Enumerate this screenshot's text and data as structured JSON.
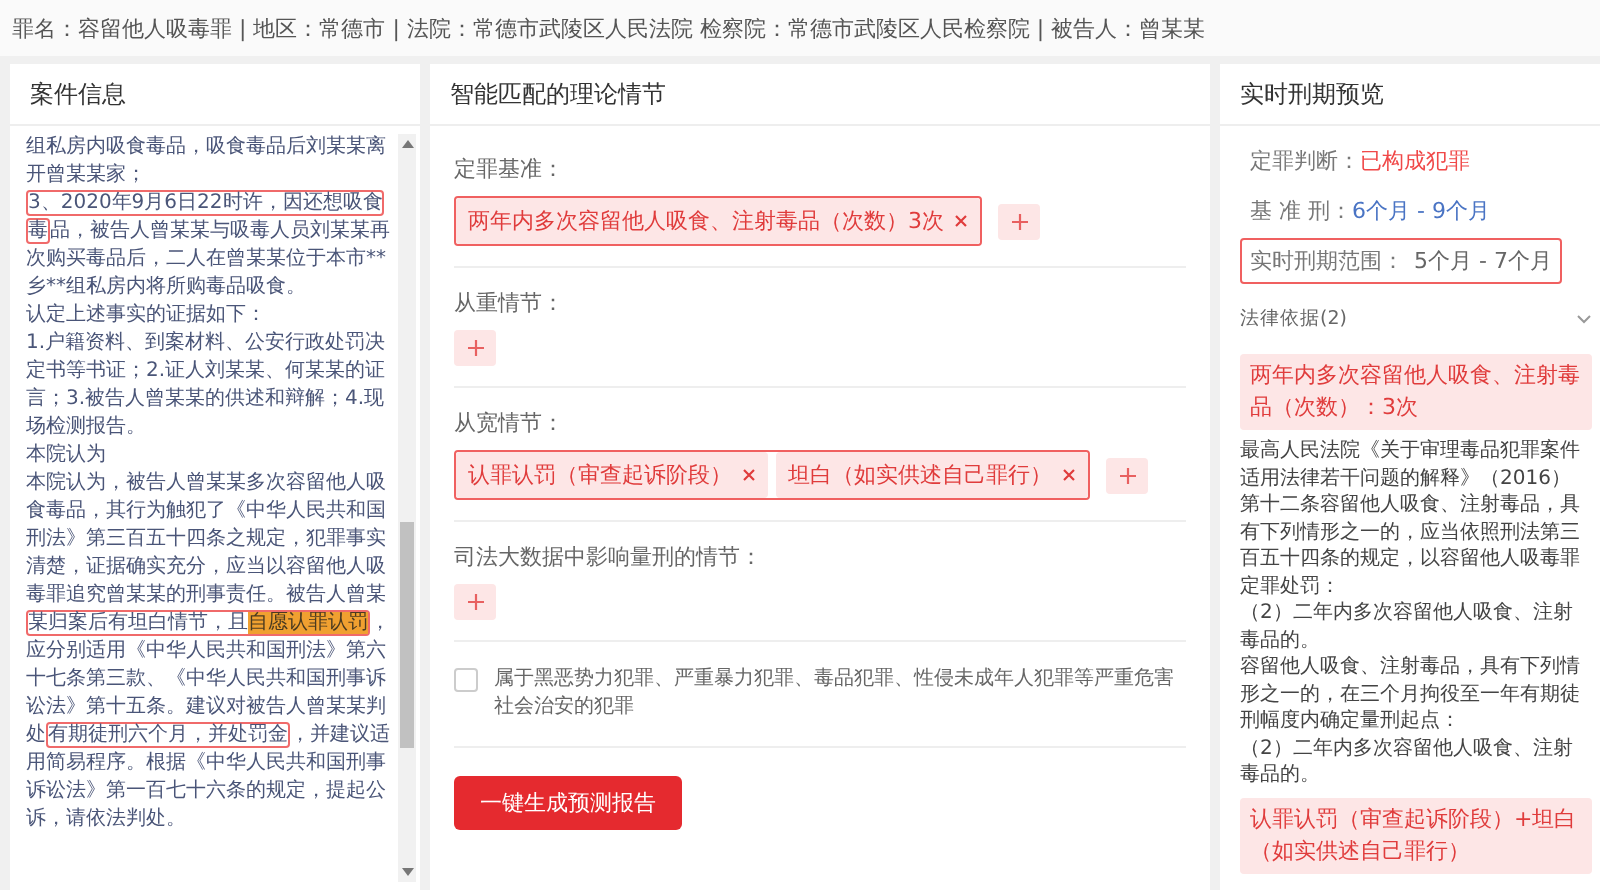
{
  "case_summary": "罪名：容留他人吸毒罪 | 地区：常德市 | 法院：常德市武陵区人民法院 检察院：常德市武陵区人民检察院 | 被告人：曾某某",
  "case_info": {
    "title": "案件信息",
    "paragraphs": [
      {
        "runs": [
          {
            "text": "组私房内吸食毒品，吸食毒品后刘某某离开曾某某家；",
            "boxed": false,
            "highlighted": false
          }
        ]
      },
      {
        "runs": [
          {
            "text": "3、2020年9月6日22时许，因还想吸食毒",
            "boxed": true,
            "highlighted": false
          },
          {
            "text": "品，被告人曾某某与吸毒人员刘某某再次购买毒品后，二人在曾某某位于本市**乡**组私房内将所购毒品吸食。",
            "boxed": false,
            "highlighted": false
          }
        ]
      },
      {
        "runs": [
          {
            "text": "认定上述事实的证据如下：",
            "boxed": false,
            "highlighted": false
          }
        ]
      },
      {
        "runs": [
          {
            "text": "1.户籍资料、到案材料、公安行政处罚决定书等书证；2.证人刘某某、何某某的证言；3.被告人曾某某的供述和辩解；4.现场检测报告。",
            "boxed": false,
            "highlighted": false
          }
        ]
      },
      {
        "runs": [
          {
            "text": "本院认为",
            "boxed": false,
            "highlighted": false
          }
        ]
      },
      {
        "runs": [
          {
            "text": "本院认为，被告人曾某某多次容留他人吸食毒品，其行为触犯了《中华人民共和国刑法》第三百五十四条之规定，犯罪事实清楚，证据确实充分，应当以容留他人吸毒罪追究曾某某的刑事责任。被告人曾某",
            "boxed": false,
            "highlighted": false
          },
          {
            "text": "某归案后有坦白情节，且",
            "boxed": true,
            "highlighted": false
          },
          {
            "text": "自愿认罪认罚",
            "boxed": true,
            "highlighted": true
          },
          {
            "text": "，应分别适用《中华人民共和国刑法》第六十七条第三款、《中华人民共和国刑事诉讼法》第十五条。建议对被告人曾某某判处",
            "boxed": false,
            "highlighted": false
          },
          {
            "text": "有期徒刑六个月，并处罚金",
            "boxed": true,
            "highlighted": false
          },
          {
            "text": "，并建议适用简易程序。根据《中华人民共和国刑事诉讼法》第一百七十六条的规定，提起公诉，请依法判处。",
            "boxed": false,
            "highlighted": false
          }
        ]
      }
    ]
  },
  "factors": {
    "title": "智能匹配的理论情节",
    "groups": [
      {
        "label": "定罪基准：",
        "boxed": true,
        "tags": [
          "两年内多次容留他人吸食、注射毒品（次数）3次"
        ]
      },
      {
        "label": "从重情节：",
        "boxed": false
      },
      {
        "label": "从宽情节：",
        "boxed": true,
        "tags": [
          "认罪认罚（审查起诉阶段）",
          "坦白（如实供述自己罪行）"
        ]
      },
      {
        "label": "司法大数据中影响量刑的情节：",
        "boxed": false
      }
    ],
    "checkbox": {
      "label": "属于黑恶势力犯罪、严重暴力犯罪、毒品犯罪、性侵未成年人犯罪等严重危害社会治安的犯罪",
      "checked": false
    },
    "generate_button": "一键生成预测报告"
  },
  "preview": {
    "title": "实时刑期预览",
    "rows": [
      {
        "label": "定罪判断：",
        "value": "已构成犯罪",
        "color": "#f04848",
        "boxed": false
      },
      {
        "label": "基 准 刑：",
        "value": "6个月 - 9个月",
        "color": "#4a74c4",
        "boxed": false
      },
      {
        "label": "实时刑期范围：",
        "value": "5个月 - 7个月",
        "color": "#666666",
        "boxed": true
      }
    ],
    "basis": {
      "title": "法律依据(2)",
      "expanded": true,
      "items": [
        {
          "kind": "highlight",
          "text": "两年内多次容留他人吸食、注射毒品（次数）：3次"
        },
        {
          "kind": "text",
          "text": "最高人民法院《关于审理毒品犯罪案件适用法律若干问题的解释》（2016）"
        },
        {
          "kind": "text",
          "text": "第十二条容留他人吸食、注射毒品，具有下列情形之一的，应当依照刑法第三百五十四条的规定，以容留他人吸毒罪定罪处罚："
        },
        {
          "kind": "text",
          "text": "（2）二年内多次容留他人吸食、注射毒品的。"
        },
        {
          "kind": "text",
          "text": "容留他人吸食、注射毒品，具有下列情形之一的，在三个月拘役至一年有期徒刑幅度内确定量刑起点："
        },
        {
          "kind": "text",
          "text": "（2）二年内多次容留他人吸食、注射毒品的。"
        },
        {
          "kind": "highlight",
          "text": "认罪认罚（审查起诉阶段）+坦白（如实供述自己罪行）"
        }
      ]
    }
  }
}
